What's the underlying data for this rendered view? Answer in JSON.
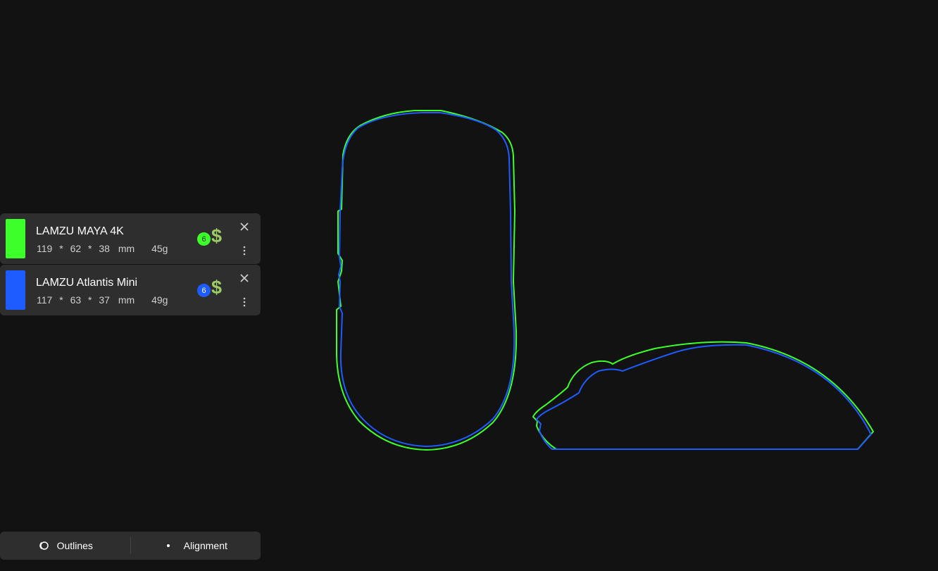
{
  "mice": [
    {
      "name": "LAMZU MAYA 4K",
      "length": "119",
      "width": "62",
      "height": "38",
      "unit": "mm",
      "weight": "45g",
      "badge": "6",
      "price_symbol": "$",
      "color": "#3dff2a"
    },
    {
      "name": "LAMZU Atlantis Mini",
      "length": "117",
      "width": "63",
      "height": "37",
      "unit": "mm",
      "weight": "49g",
      "badge": "6",
      "price_symbol": "$",
      "color": "#1f5cff"
    }
  ],
  "multiply_symbol": "*",
  "toolbar": {
    "outlines_label": "Outlines",
    "alignment_label": "Alignment"
  },
  "colors": {
    "background": "#121212",
    "card": "#2e2e2e",
    "price": "#9ccc65"
  }
}
